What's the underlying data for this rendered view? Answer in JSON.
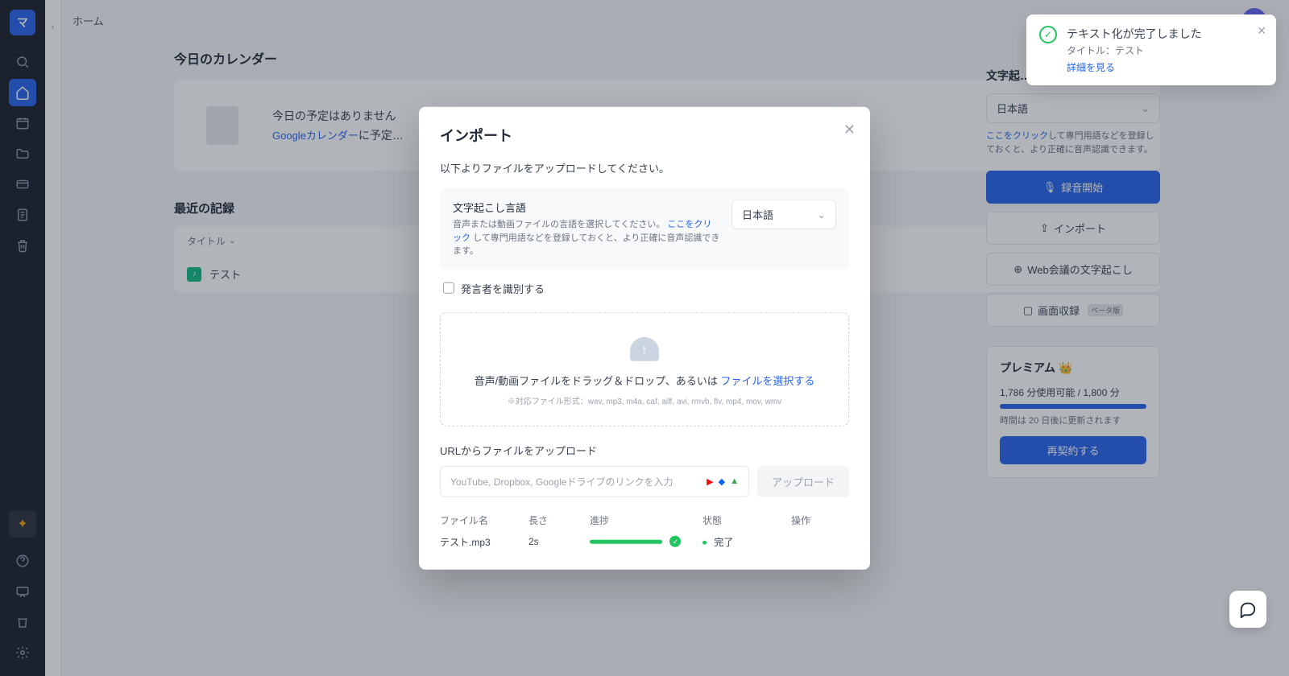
{
  "breadcrumb": "ホーム",
  "main": {
    "calendar_title": "今日のカレンダー",
    "calendar_empty": "今日の予定はありません",
    "calendar_link_text": "Googleカレンダー",
    "calendar_link_suffix": "に予定…",
    "recent_title": "最近の記録",
    "column_title": "タイトル",
    "row_title": "テスト"
  },
  "right": {
    "title_prefix": "文字起…",
    "lang": "日本語",
    "hint_link": "ここをクリック",
    "hint_rest": "して専門用語などを登録しておくと、より正確に音声認識できます。",
    "btn_record": "録音開始",
    "btn_import": "インポート",
    "btn_meeting": "Web会議の文字起こし",
    "btn_screen": "画面収録",
    "beta": "ベータ版",
    "premium_title": "プレミアム",
    "premium_usage": "1,786 分使用可能 / 1,800 分",
    "premium_note": "時間は 20 日後に更新されます",
    "premium_btn": "再契約する"
  },
  "modal": {
    "title": "インポート",
    "subtitle": "以下よりファイルをアップロードしてください。",
    "lang_label": "文字起こし言語",
    "lang_desc_prefix": "音声または動画ファイルの言語を選択してください。",
    "lang_desc_link": "ここをクリック",
    "lang_desc_suffix": "して専門用語などを登録しておくと、より正確に音声認識できます。",
    "lang_value": "日本語",
    "checkbox_label": "発言者を識別する",
    "drop_text_prefix": "音声/動画ファイルをドラッグ＆ドロップ、あるいは ",
    "drop_text_link": "ファイルを選択する",
    "drop_formats": "※対応ファイル形式：wav, mp3, m4a, caf, aiff, avi, rmvb, flv, mp4, mov, wmv",
    "url_label": "URLからファイルをアップロード",
    "url_placeholder": "YouTube, Dropbox, Googleドライブのリンクを入力",
    "upload_btn": "アップロード",
    "col_name": "ファイル名",
    "col_len": "長さ",
    "col_prog": "進捗",
    "col_state": "状態",
    "col_act": "操作",
    "file_name": "テスト.mp3",
    "file_len": "2s",
    "file_state": "完了"
  },
  "toast": {
    "title": "テキスト化が完了しました",
    "subtitle": "タイトル：テスト",
    "link": "詳細を見る"
  },
  "logo_text": "マ"
}
